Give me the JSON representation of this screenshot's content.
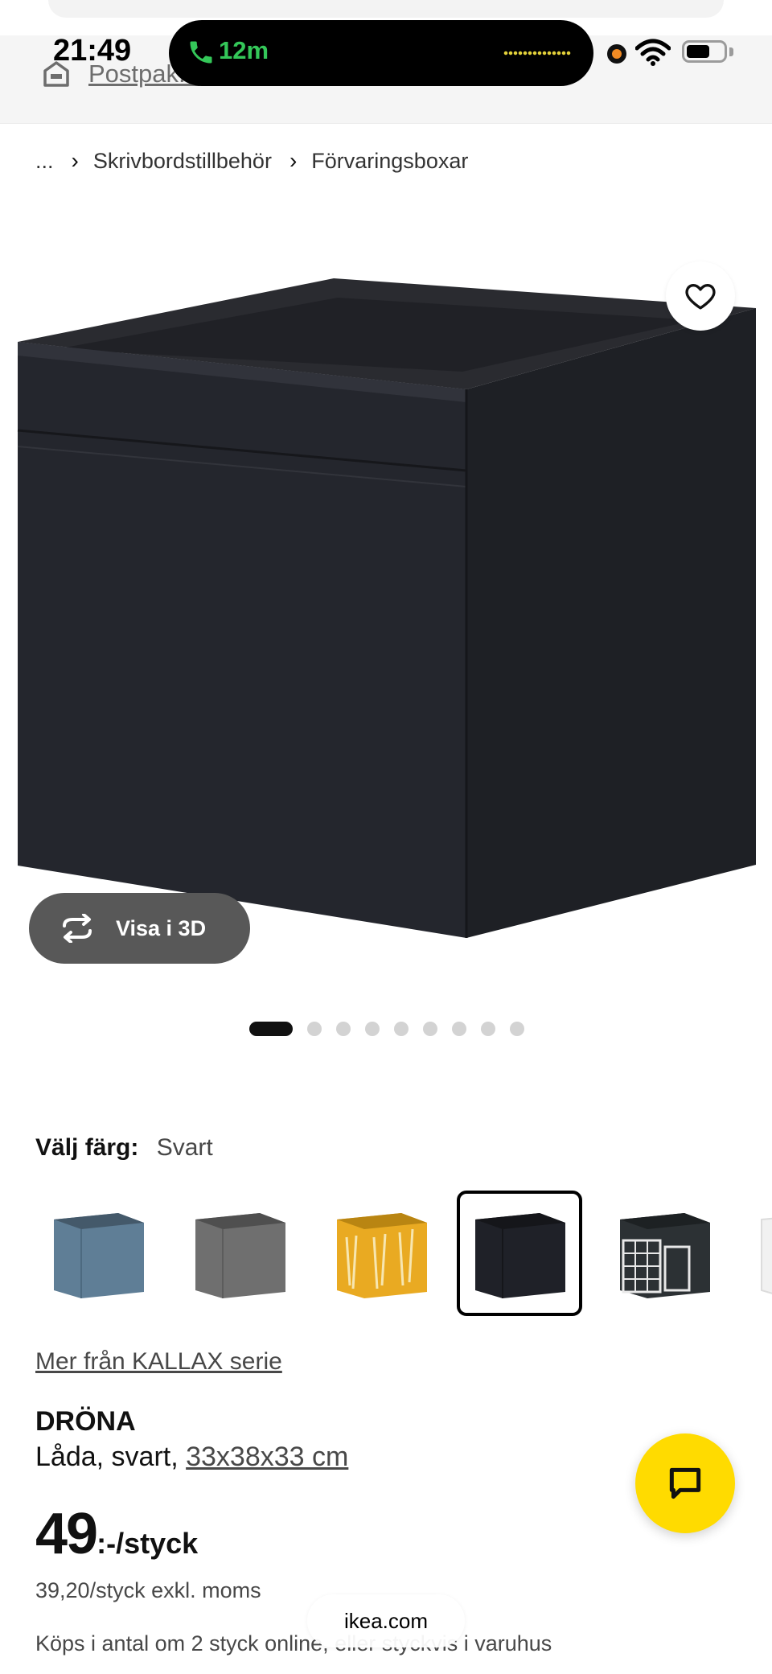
{
  "status_bar": {
    "time": "21:49",
    "call_duration": "12m"
  },
  "header": {
    "postal_text": "Postpak..."
  },
  "breadcrumb": {
    "items": [
      "...",
      "Skrivbordstillbehör",
      "Förvaringsboxar"
    ]
  },
  "gallery": {
    "view_3d_label": "Visa i 3D",
    "image_count": 9,
    "active_index": 0
  },
  "color_picker": {
    "label": "Välj färg:",
    "selected": "Svart",
    "swatches": [
      {
        "name": "blue-gray",
        "color": "#5f7e96"
      },
      {
        "name": "gray",
        "color": "#6f6f6f"
      },
      {
        "name": "yellow-pattern",
        "color": "#e9aa22"
      },
      {
        "name": "black",
        "color": "#1f2128",
        "selected": true
      },
      {
        "name": "black-building-print",
        "color": "#2c3134"
      },
      {
        "name": "white",
        "color": "#f1f1f1"
      }
    ]
  },
  "product": {
    "series_link": "Mer från KALLAX serie",
    "name": "DRÖNA",
    "description_prefix": "Låda, svart, ",
    "size": "33x38x33 cm",
    "price_main": "49",
    "price_suffix": ":-/styck",
    "price_ex_vat": "39,20/styck exkl. moms",
    "buy_note": "Köps i antal om 2 styck online, eller styckvis i varuhus"
  },
  "browser": {
    "url": "ikea.com"
  },
  "colors": {
    "chat_button": "#ffdb00",
    "call_green": "#34c759"
  }
}
